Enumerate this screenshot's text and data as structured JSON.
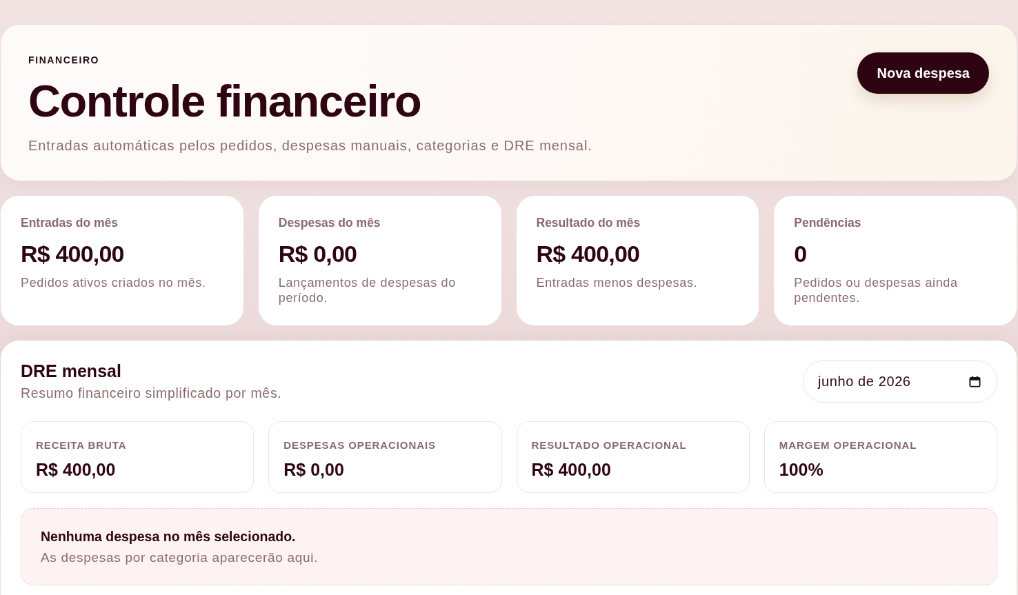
{
  "header": {
    "eyebrow": "FINANCEIRO",
    "title": "Controle financeiro",
    "subtitle": "Entradas automáticas pelos pedidos, despesas manuais, categorias e DRE mensal.",
    "action": "Nova despesa"
  },
  "stats": [
    {
      "label": "Entradas do mês",
      "value": "R$ 400,00",
      "note": "Pedidos ativos criados no mês."
    },
    {
      "label": "Despesas do mês",
      "value": "R$ 0,00",
      "note": "Lançamentos de despesas do período."
    },
    {
      "label": "Resultado do mês",
      "value": "R$ 400,00",
      "note": "Entradas menos despesas."
    },
    {
      "label": "Pendências",
      "value": "0",
      "note": "Pedidos ou despesas ainda pendentes."
    }
  ],
  "dre": {
    "title": "DRE mensal",
    "subtitle": "Resumo financeiro simplificado por mês.",
    "month": "junho de 2026",
    "metrics": [
      {
        "label": "RECEITA BRUTA",
        "value": "R$ 400,00"
      },
      {
        "label": "DESPESAS OPERACIONAIS",
        "value": "R$ 0,00"
      },
      {
        "label": "RESULTADO OPERACIONAL",
        "value": "R$ 400,00"
      },
      {
        "label": "MARGEM OPERACIONAL",
        "value": "100%"
      }
    ],
    "empty": {
      "title": "Nenhuma despesa no mês selecionado.",
      "text": "As despesas por categoria aparecerão aqui."
    }
  }
}
